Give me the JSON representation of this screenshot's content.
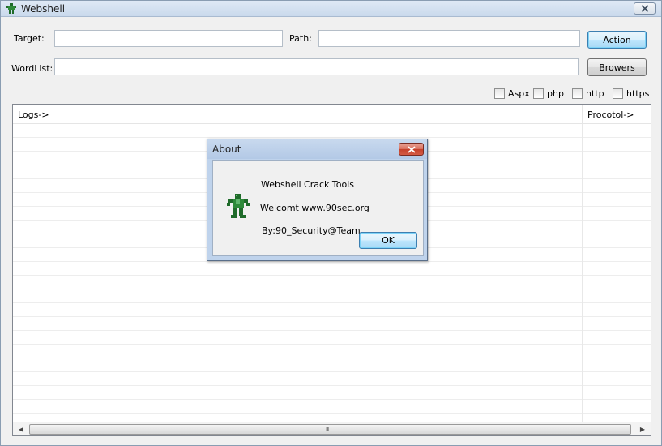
{
  "window": {
    "title": "Webshell",
    "app_icon": "green-figure-icon",
    "close_icon": "close-icon"
  },
  "form": {
    "target_label": "Target:",
    "target_value": "",
    "path_label": "Path:",
    "path_value": "",
    "action_button": "Action",
    "wordlist_label": "WordList:",
    "wordlist_value": "",
    "browse_button": "Browers"
  },
  "options": [
    {
      "label": "Aspx",
      "checked": false
    },
    {
      "label": "php",
      "checked": false
    },
    {
      "label": "http",
      "checked": false
    },
    {
      "label": "https",
      "checked": false
    }
  ],
  "list": {
    "columns": [
      "Logs->",
      "Procotol->"
    ],
    "rows": []
  },
  "scrollbar": {
    "left_arrow": "◀",
    "right_arrow": "▶",
    "grip": "III"
  },
  "about_dialog": {
    "title": "About",
    "line1": "Webshell Crack Tools",
    "line2": "Welcomt www.90sec.org",
    "line3": "By:90_Security@Team",
    "ok_button": "OK",
    "icon": "green-figure-icon"
  },
  "colors": {
    "icon_green": "#1f6b2a",
    "default_button_border": "#3c7fb1",
    "close_red": "#c5412b"
  }
}
